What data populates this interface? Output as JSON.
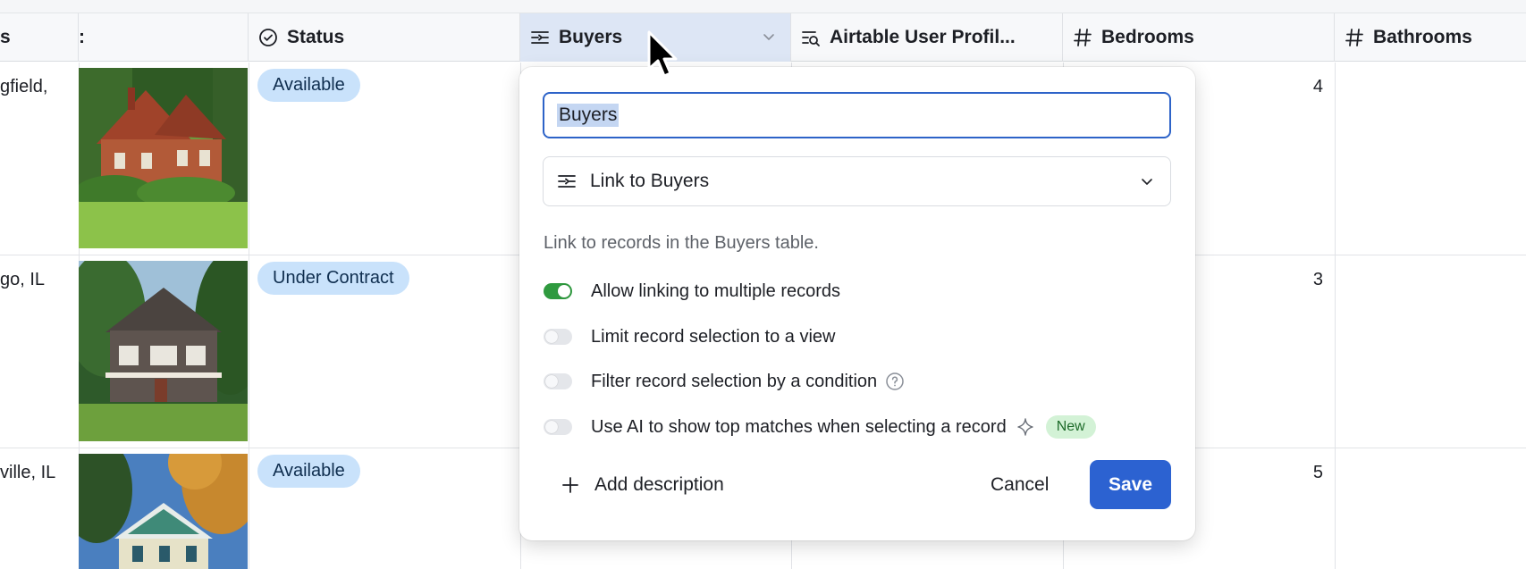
{
  "header": {
    "col_a_fragment": "s",
    "col_b_fragment": "!",
    "status": "Status",
    "buyers": "Buyers",
    "profile": "Airtable User Profil...",
    "bedrooms": "Bedrooms",
    "bathrooms": "Bathrooms"
  },
  "rows": [
    {
      "address": "gfield,",
      "status": "Available",
      "bedrooms": "4"
    },
    {
      "address": "go, IL",
      "status": "Under Contract",
      "bedrooms": "3"
    },
    {
      "address": "ville, IL",
      "status": "Available",
      "bedrooms": "5"
    }
  ],
  "popup": {
    "field_name": "Buyers",
    "type_label": "Link to Buyers",
    "description": "Link to records in the Buyers table.",
    "options": [
      {
        "label": "Allow linking to multiple records",
        "on": true
      },
      {
        "label": "Limit record selection to a view",
        "on": false
      },
      {
        "label": "Filter record selection by a condition",
        "on": false
      },
      {
        "label": "Use AI to show top matches when selecting a record",
        "on": false
      }
    ],
    "new_badge": "New",
    "add_description": "Add description",
    "cancel": "Cancel",
    "save": "Save"
  },
  "colors": {
    "accent": "#2c62d1",
    "pill": "#c9e2fb",
    "toggle_on": "#2f9a3f"
  }
}
